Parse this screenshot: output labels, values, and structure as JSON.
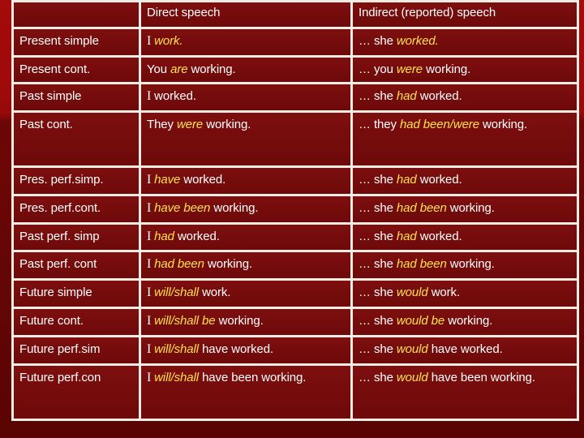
{
  "slide": {
    "background_color": "#6d0606",
    "accent_highlight_color": "#ffe14d",
    "text_color": "#ffffff",
    "gridline_color": "#f6ece3",
    "cell_color": "#760c0c"
  },
  "table": {
    "name": "direct-and-indirect-speech-tense-changes",
    "headers": {
      "corner": "",
      "direct": "Direct speech",
      "indirect": "Indirect (reported) speech"
    },
    "rows": [
      {
        "tense": "Present simple",
        "direct": [
          {
            "text": "I ",
            "style": "serif-plain"
          },
          {
            "text": "work.",
            "style": "highlight"
          }
        ],
        "indirect": [
          {
            "text": "… she ",
            "style": "plain"
          },
          {
            "text": "worked.",
            "style": "highlight"
          }
        ]
      },
      {
        "tense": "Present cont.",
        "direct": [
          {
            "text": "You ",
            "style": "plain"
          },
          {
            "text": "are",
            "style": "highlight"
          },
          {
            "text": " working.",
            "style": "plain"
          }
        ],
        "indirect": [
          {
            "text": "… you ",
            "style": "plain"
          },
          {
            "text": "were",
            "style": "highlight"
          },
          {
            "text": " working.",
            "style": "plain"
          }
        ]
      },
      {
        "tense": "Past simple",
        "direct": [
          {
            "text": "I ",
            "style": "serif-plain"
          },
          {
            "text": "worked.",
            "style": "plain"
          }
        ],
        "indirect": [
          {
            "text": "… she ",
            "style": "plain"
          },
          {
            "text": "had",
            "style": "highlight"
          },
          {
            "text": " worked.",
            "style": "plain"
          }
        ]
      },
      {
        "tense": "Past cont.",
        "direct": [
          {
            "text": "They ",
            "style": "plain"
          },
          {
            "text": "were",
            "style": "highlight"
          },
          {
            "text": " working.",
            "style": "plain"
          }
        ],
        "indirect": [
          {
            "text": "… they ",
            "style": "plain"
          },
          {
            "text": "had been/were",
            "style": "highlight"
          },
          {
            "text": " working.",
            "style": "plain"
          }
        ]
      },
      {
        "tense": "Pres. perf.simp.",
        "direct": [
          {
            "text": "I ",
            "style": "serif-plain"
          },
          {
            "text": "have",
            "style": "highlight"
          },
          {
            "text": " worked.",
            "style": "plain"
          }
        ],
        "indirect": [
          {
            "text": "… she ",
            "style": "plain"
          },
          {
            "text": "had",
            "style": "highlight"
          },
          {
            "text": " worked.",
            "style": "plain"
          }
        ]
      },
      {
        "tense": "Pres. perf.cont.",
        "direct": [
          {
            "text": "I ",
            "style": "serif-plain"
          },
          {
            "text": "have been",
            "style": "highlight"
          },
          {
            "text": " working.",
            "style": "plain"
          }
        ],
        "indirect": [
          {
            "text": "… she ",
            "style": "plain"
          },
          {
            "text": "had been",
            "style": "highlight"
          },
          {
            "text": " working.",
            "style": "plain"
          }
        ]
      },
      {
        "tense": "Past perf. simp",
        "direct": [
          {
            "text": "I ",
            "style": "serif-plain"
          },
          {
            "text": "had",
            "style": "highlight"
          },
          {
            "text": " worked.",
            "style": "plain"
          }
        ],
        "indirect": [
          {
            "text": "… she ",
            "style": "plain"
          },
          {
            "text": "had",
            "style": "highlight"
          },
          {
            "text": " worked.",
            "style": "plain"
          }
        ]
      },
      {
        "tense": "Past perf. cont",
        "direct": [
          {
            "text": "I ",
            "style": "serif-plain"
          },
          {
            "text": "had been",
            "style": "highlight"
          },
          {
            "text": " working.",
            "style": "plain"
          }
        ],
        "indirect": [
          {
            "text": "… she ",
            "style": "plain"
          },
          {
            "text": "had been",
            "style": "highlight"
          },
          {
            "text": " working.",
            "style": "plain"
          }
        ]
      },
      {
        "tense": "Future simple",
        "direct": [
          {
            "text": "I ",
            "style": "serif-plain"
          },
          {
            "text": "will/shall",
            "style": "highlight"
          },
          {
            "text": " work.",
            "style": "plain"
          }
        ],
        "indirect": [
          {
            "text": "… she ",
            "style": "plain"
          },
          {
            "text": "would",
            "style": "highlight"
          },
          {
            "text": " work.",
            "style": "plain"
          }
        ]
      },
      {
        "tense": "Future cont.",
        "direct": [
          {
            "text": "I ",
            "style": "serif-plain"
          },
          {
            "text": "will/shall be",
            "style": "highlight"
          },
          {
            "text": " working.",
            "style": "plain"
          }
        ],
        "indirect": [
          {
            "text": "… she ",
            "style": "plain"
          },
          {
            "text": "would be",
            "style": "highlight"
          },
          {
            "text": " working.",
            "style": "plain"
          }
        ]
      },
      {
        "tense": "Future perf.sim",
        "direct": [
          {
            "text": "I ",
            "style": "serif-plain"
          },
          {
            "text": "will/shall",
            "style": "highlight"
          },
          {
            "text": " have worked.",
            "style": "plain"
          }
        ],
        "indirect": [
          {
            "text": "… she ",
            "style": "plain"
          },
          {
            "text": "would",
            "style": "highlight"
          },
          {
            "text": " have worked.",
            "style": "plain"
          }
        ]
      },
      {
        "tense": "Future perf.con",
        "direct": [
          {
            "text": "I ",
            "style": "serif-plain"
          },
          {
            "text": "will/shall",
            "style": "highlight"
          },
          {
            "text": " have been working.",
            "style": "plain"
          }
        ],
        "indirect": [
          {
            "text": "… she ",
            "style": "plain"
          },
          {
            "text": "would",
            "style": "highlight"
          },
          {
            "text": " have been working.",
            "style": "plain"
          }
        ]
      }
    ]
  }
}
